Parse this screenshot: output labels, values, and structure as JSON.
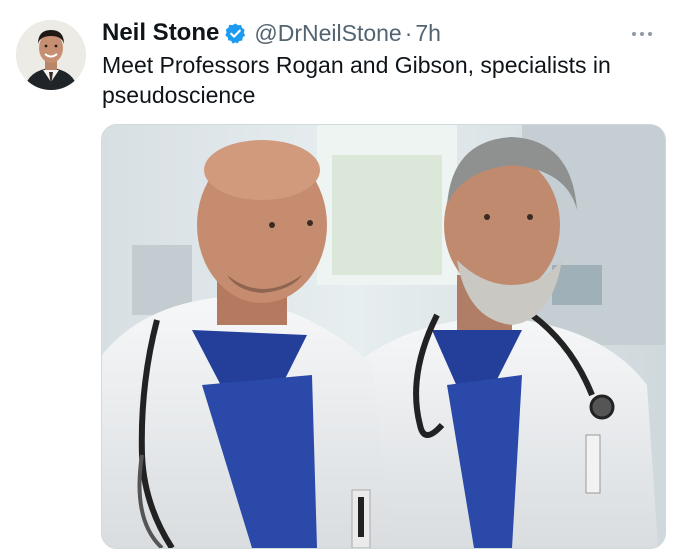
{
  "tweet": {
    "author_name": "Neil Stone",
    "handle": "@DrNeilStone",
    "separator": "·",
    "time": "7h",
    "text": "Meet Professors Rogan and Gibson, specialists in pseudoscience",
    "verified": true
  },
  "icons": {
    "verified": "verified-badge-icon",
    "more": "more-options-icon"
  },
  "colors": {
    "verified_blue": "#1d9bf0",
    "name_text": "#0f1419",
    "secondary_text": "#536471",
    "scrubs_blue": "#233f9a"
  }
}
